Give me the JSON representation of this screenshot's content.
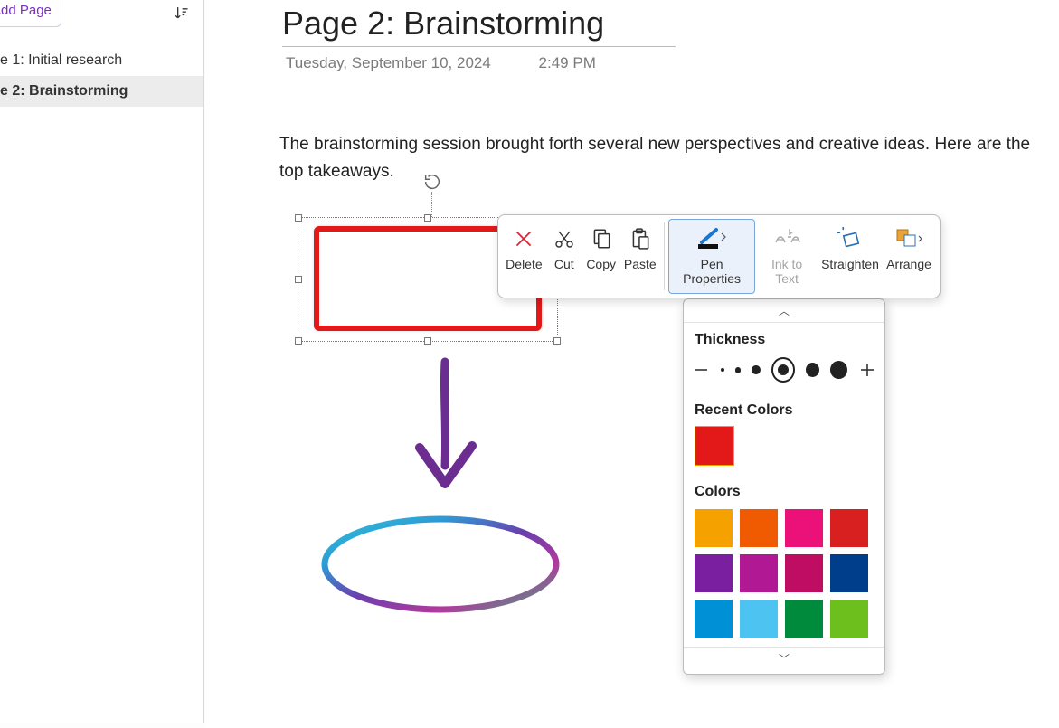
{
  "sidebar": {
    "add_page_label": "Add Page",
    "items": [
      {
        "label": "e 1: Initial research",
        "active": false
      },
      {
        "label": "e 2: Brainstorming",
        "active": true
      }
    ]
  },
  "page": {
    "title": "Page 2: Brainstorming",
    "date": "Tuesday, September 10, 2024",
    "time": "2:49 PM",
    "body": "The brainstorming session brought forth several new perspectives and creative ideas. Here are the top takeaways."
  },
  "toolbar": {
    "delete": "Delete",
    "cut": "Cut",
    "copy": "Copy",
    "paste": "Paste",
    "pen_properties": "Pen Properties",
    "ink_to_text": "Ink to Text",
    "straighten": "Straighten",
    "arrange": "Arrange"
  },
  "pen_popover": {
    "thickness_label": "Thickness",
    "recent_label": "Recent Colors",
    "colors_label": "Colors",
    "recent_colors": [
      "#e31818"
    ],
    "thickness_levels": [
      3,
      6,
      9,
      12,
      16,
      20
    ],
    "selected_thickness_index": 3,
    "palette": [
      "#f5a100",
      "#f05a00",
      "#ec1179",
      "#d92020",
      "#7a1fa0",
      "#b01894",
      "#be0d63",
      "#003e8c",
      "#0090d6",
      "#4cc3f0",
      "#008a3c",
      "#6cbf1d"
    ]
  }
}
